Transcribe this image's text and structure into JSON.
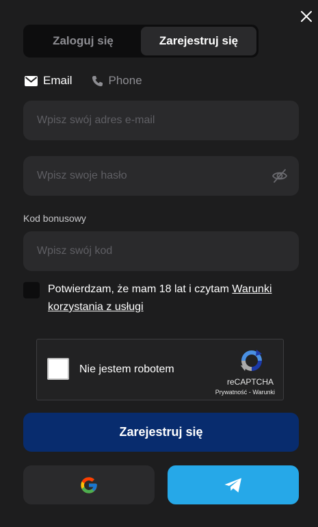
{
  "tabs": {
    "login_label": "Zaloguj się",
    "register_label": "Zarejestruj się"
  },
  "methods": {
    "email_label": "Email",
    "phone_label": "Phone"
  },
  "form": {
    "email_placeholder": "Wpisz swój adres e-mail",
    "password_placeholder": "Wpisz swoje hasło",
    "bonus_label": "Kod bonusowy",
    "bonus_placeholder": "Wpisz swój kod"
  },
  "terms": {
    "text": "Potwierdzam, że mam 18 lat i czytam ",
    "link": "Warunki korzystania z usługi"
  },
  "recaptcha": {
    "label": "Nie jestem robotem",
    "brand": "reCAPTCHA",
    "privacy": "Prywatność",
    "separator": " - ",
    "terms": "Warunki"
  },
  "submit_label": "Zarejestruj się",
  "colors": {
    "background": "#1d1d1e",
    "submit": "#082c6e",
    "telegram": "#26a8e8"
  },
  "icons": {
    "close": "close-icon",
    "email": "envelope-icon",
    "phone": "phone-icon",
    "eye": "eye-slash-icon",
    "google": "google-icon",
    "telegram": "telegram-icon"
  }
}
